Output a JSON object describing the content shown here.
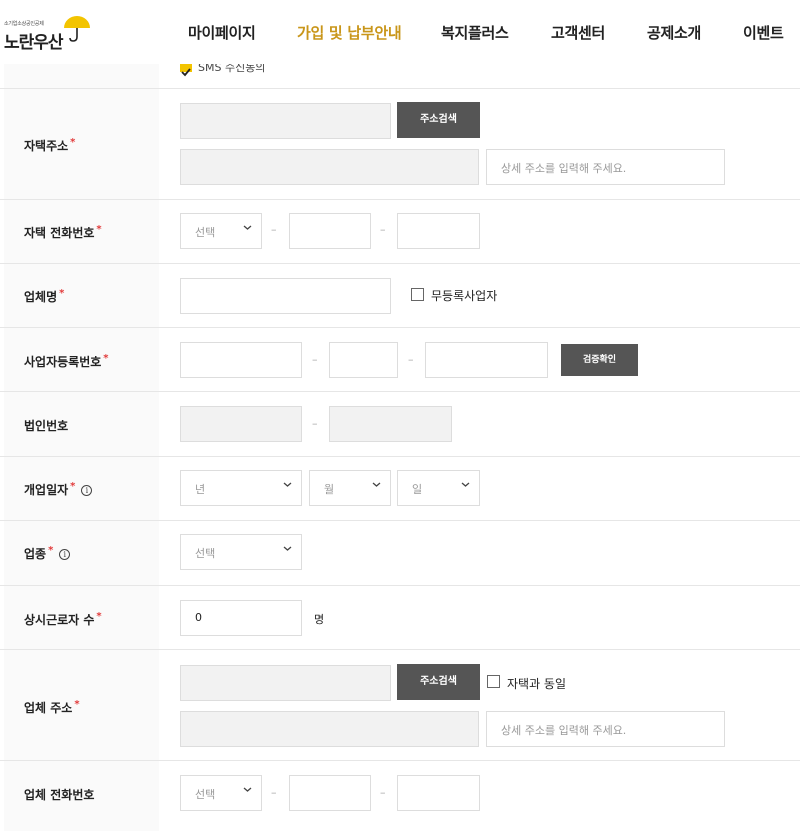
{
  "header": {
    "logo_sub": "소기업소상공인공제",
    "logo_main": "노란우산",
    "nav": [
      {
        "label": "마이페이지",
        "active": false
      },
      {
        "label": "가입 및 납부안내",
        "active": true
      },
      {
        "label": "복지플러스",
        "active": false
      },
      {
        "label": "고객센터",
        "active": false
      },
      {
        "label": "공제소개",
        "active": false
      },
      {
        "label": "이벤트",
        "active": false
      }
    ]
  },
  "sms": {
    "label": "SMS 수신동의",
    "checked": true
  },
  "required_mark": "*",
  "form": {
    "home_address": {
      "label": "자택주소",
      "search_button": "주소검색",
      "detail_placeholder": "상세 주소를 입력해 주세요."
    },
    "home_phone": {
      "label": "자택 전화번호",
      "select_value": "선택",
      "dash": "–"
    },
    "company_name": {
      "label": "업체명",
      "unregistered_label": "무등록사업자"
    },
    "business_reg_no": {
      "label": "사업자등록번호",
      "dash": "–",
      "verify_button": "검증확인"
    },
    "corporate_no": {
      "label": "법인번호",
      "dash": "–"
    },
    "opening_date": {
      "label": "개업일자",
      "info_icon": "i",
      "year_placeholder": "년",
      "month_placeholder": "월",
      "day_placeholder": "일"
    },
    "industry": {
      "label": "업종",
      "info_icon": "i",
      "select_value": "선택"
    },
    "employees": {
      "label": "상시근로자 수",
      "value": "0",
      "unit": "명"
    },
    "company_address": {
      "label": "업체 주소",
      "search_button": "주소검색",
      "same_as_home_label": "자택과 동일",
      "detail_placeholder": "상세 주소를 입력해 주세요."
    },
    "company_phone": {
      "label": "업체 전화번호",
      "select_value": "선택",
      "dash": "–"
    }
  },
  "colors": {
    "accent": "#c9961a",
    "required": "#e23b3b",
    "button_dark": "#555555",
    "logo_yellow": "#f3c400"
  }
}
